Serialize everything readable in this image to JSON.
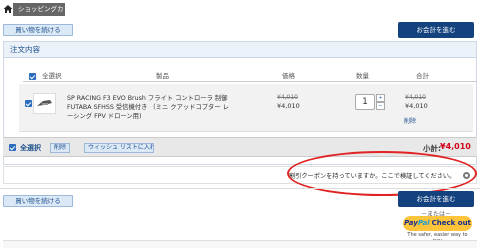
{
  "breadcrumb": {
    "label": "ショッピングカ"
  },
  "buttons": {
    "continue_shopping": "買い物を続ける",
    "checkout": "お会計を進む"
  },
  "panel": {
    "title": "注文内容"
  },
  "table": {
    "select_all": "全選択",
    "col_product": "製品",
    "col_price": "価格",
    "col_qty": "数量",
    "col_total": "合計"
  },
  "item": {
    "name": "SP RACING F3 EVO Brush フライト コントローラ 制御 FUTABA SFHSS 受信機付き （ミニ クアッドコプター レーシング FPV ドローン用)",
    "price_old": "¥4,010",
    "price": "¥4,010",
    "qty": "1",
    "qty_up": "+",
    "qty_down": "−",
    "total_old": "¥4,010",
    "total": "¥4,010",
    "remove": "削除"
  },
  "select_bar": {
    "select_all": "全選択",
    "delete": "削除",
    "wishlist": "ウィッシュ リストに入れる",
    "subtotal_label": "小計:",
    "subtotal_value": "¥4,010"
  },
  "coupon": {
    "text": "割引クーポンを持っていますか。ここで検証してください。"
  },
  "alt": {
    "text": "－または－"
  },
  "paypal": {
    "word1": "Pay",
    "word2": "Pal",
    "word3": "Check out",
    "tagline": "The safer, easier way to pay"
  },
  "colors": {
    "accent": "#13427e",
    "price_red": "#d0021b",
    "paypal_yellow": "#ffc43a",
    "annotation_red": "#e12222"
  }
}
